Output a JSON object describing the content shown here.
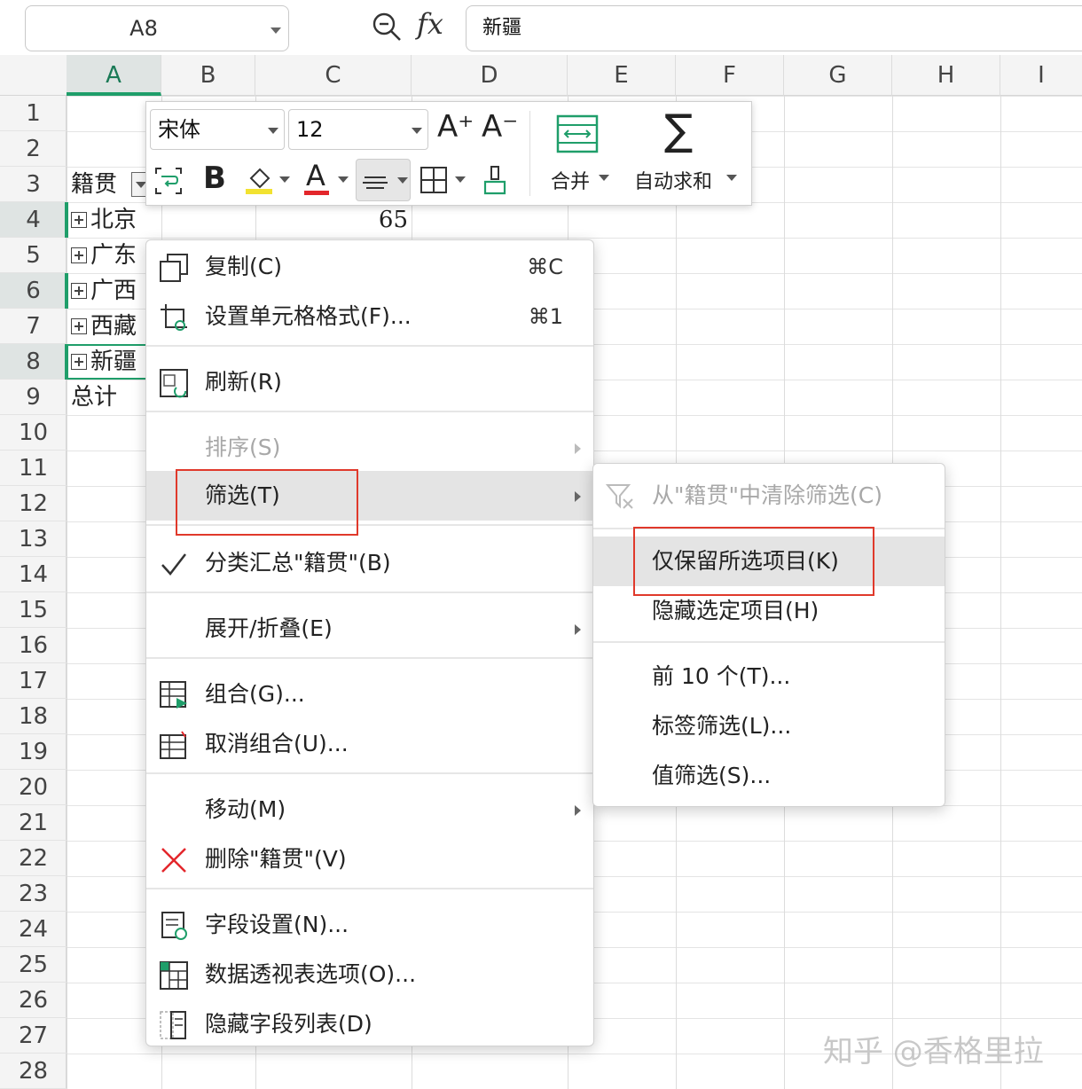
{
  "formula_bar": {
    "name_box": "A8",
    "fx": "fx",
    "formula": "新疆"
  },
  "columns": [
    "A",
    "B",
    "C",
    "D",
    "E",
    "F",
    "G",
    "H",
    "I"
  ],
  "rows": [
    "1",
    "2",
    "3",
    "4",
    "5",
    "6",
    "7",
    "8",
    "9",
    "10",
    "11",
    "12",
    "13",
    "14",
    "15",
    "16",
    "17",
    "18",
    "19",
    "20",
    "21",
    "22",
    "23",
    "24",
    "25",
    "26",
    "27",
    "28"
  ],
  "cells": {
    "a3": "籍贯",
    "a4": "北京",
    "a5": "广东",
    "a6": "广西",
    "a7": "西藏",
    "a8": "新疆",
    "a9": "总计",
    "c4": "65"
  },
  "toolbar": {
    "font_name": "宋体",
    "font_size": "12",
    "increase_font": "A⁺",
    "decrease_font": "A⁻",
    "bold": "B",
    "font_color_letter": "A",
    "merge_label": "合并",
    "autosum_label": "自动求和"
  },
  "context_menu": {
    "items": [
      {
        "label": "复制(C)",
        "shortcut": "⌘C"
      },
      {
        "label": "设置单元格格式(F)...",
        "shortcut": "⌘1"
      },
      {
        "label": "刷新(R)"
      },
      {
        "label": "排序(S)"
      },
      {
        "label": "筛选(T)"
      },
      {
        "label": "分类汇总\"籍贯\"(B)"
      },
      {
        "label": "展开/折叠(E)"
      },
      {
        "label": "组合(G)..."
      },
      {
        "label": "取消组合(U)..."
      },
      {
        "label": "移动(M)"
      },
      {
        "label": "删除\"籍贯\"(V)"
      },
      {
        "label": "字段设置(N)..."
      },
      {
        "label": "数据透视表选项(O)..."
      },
      {
        "label": "隐藏字段列表(D)"
      }
    ]
  },
  "submenu": {
    "items": [
      {
        "label": "从\"籍贯\"中清除筛选(C)"
      },
      {
        "label": "仅保留所选项目(K)"
      },
      {
        "label": "隐藏选定项目(H)"
      },
      {
        "label": "前 10 个(T)..."
      },
      {
        "label": "标签筛选(L)..."
      },
      {
        "label": "值筛选(S)..."
      }
    ]
  },
  "colors": {
    "accent_green": "#1f9e6a",
    "highlight_red": "#e0392b"
  },
  "watermark": "知乎 @香格里拉"
}
